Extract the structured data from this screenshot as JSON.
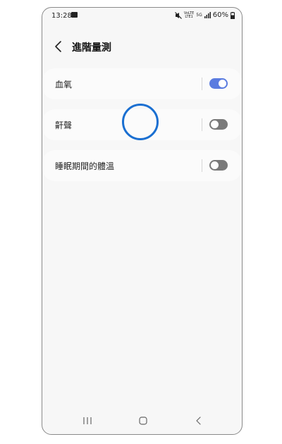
{
  "status_bar": {
    "time": "13:28",
    "volte_top": "VoLTE",
    "volte_bottom": "LTE1",
    "network": "5G",
    "battery": "60%"
  },
  "header": {
    "title": "進階量測"
  },
  "settings": [
    {
      "label": "血氧",
      "enabled": true
    },
    {
      "label": "鼾聲",
      "enabled": false
    },
    {
      "label": "睡眠期間的體溫",
      "enabled": false
    }
  ],
  "colors": {
    "toggle_on": "#5b7ce0",
    "toggle_off": "#7a7a7a",
    "touch_ring": "#1a6fd1"
  }
}
